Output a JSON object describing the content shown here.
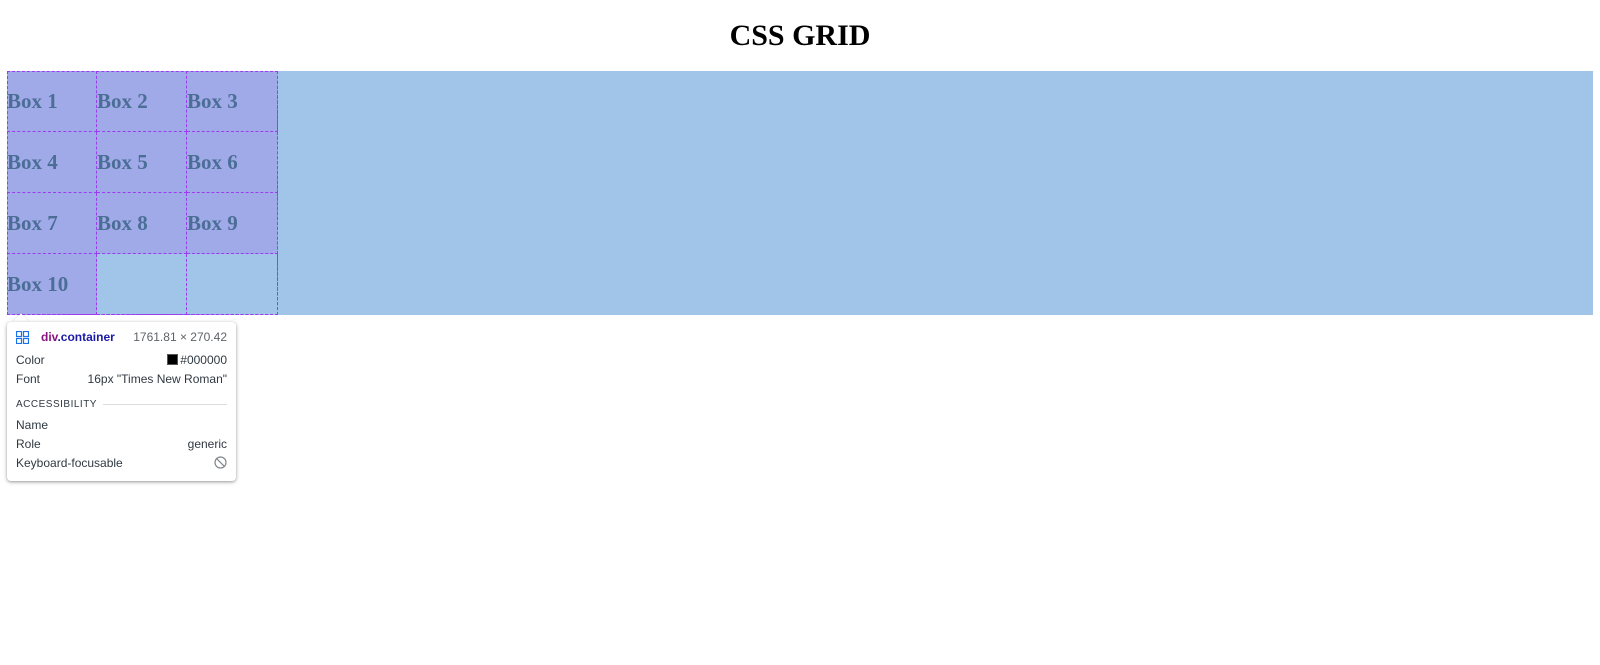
{
  "page": {
    "title": "CSS GRID"
  },
  "grid": {
    "boxes": [
      "Box 1",
      "Box 2",
      "Box 3",
      "Box 4",
      "Box 5",
      "Box 6",
      "Box 7",
      "Box 8",
      "Box 9",
      "Box 10"
    ]
  },
  "tooltip": {
    "tag": "div",
    "class_name": ".container",
    "dimensions": "1761.81 × 270.42",
    "color_label": "Color",
    "color_value": "#000000",
    "font_label": "Font",
    "font_value": "16px \"Times New Roman\"",
    "section_title": "ACCESSIBILITY",
    "name_label": "Name",
    "name_value": "",
    "role_label": "Role",
    "role_value": "generic",
    "focusable_label": "Keyboard-focusable",
    "icons": {
      "element": "grid-icon",
      "focusable": "not-allowed-icon"
    }
  },
  "colors": {
    "container_bg": "#a1c4e9",
    "grid_line": "#9b3cf0",
    "box_text": "#4a6e96"
  }
}
